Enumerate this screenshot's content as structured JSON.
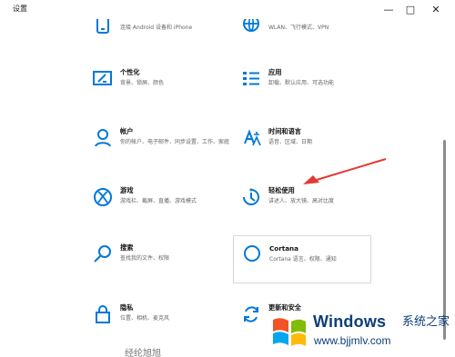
{
  "window": {
    "title": "设置"
  },
  "tiles": [
    {
      "title": "",
      "description": "连接 Android 设备和 iPhone",
      "icon": "phone-icon"
    },
    {
      "title": "",
      "description": "WLAN、飞行模式、VPN",
      "icon": "globe-icon"
    },
    {
      "title": "个性化",
      "description": "背景、锁屏、颜色",
      "icon": "personalization-icon"
    },
    {
      "title": "应用",
      "description": "卸载、默认应用、可选功能",
      "icon": "apps-icon"
    },
    {
      "title": "帐户",
      "description": "你的帐户、电子邮件、同步设置、工作、家庭",
      "icon": "account-icon"
    },
    {
      "title": "时间和语言",
      "description": "语音、区域、日期",
      "icon": "time-language-icon"
    },
    {
      "title": "游戏",
      "description": "游戏栏、截屏、直播、游戏模式",
      "icon": "xbox-icon"
    },
    {
      "title": "轻松使用",
      "description": "讲述人、放大镜、高对比度",
      "icon": "ease-of-access-icon"
    },
    {
      "title": "搜索",
      "description": "查找我的文件、权限",
      "icon": "search-icon"
    },
    {
      "title": "Cortana",
      "description": "Cortana 语言、权限、通知",
      "icon": "cortana-icon"
    },
    {
      "title": "隐私",
      "description": "位置、相机、麦克风",
      "icon": "lock-icon"
    },
    {
      "title": "更新和安全",
      "description": "",
      "icon": "update-icon"
    }
  ],
  "bottom_cutoff": "经纶旭旭",
  "watermark": {
    "brand": "Windows",
    "tag": "系统之家",
    "url": "www.bjjmlv.com"
  },
  "colors": {
    "accent": "#0078d7",
    "arrow": "#e53935",
    "watermark": "#0c3f78"
  }
}
